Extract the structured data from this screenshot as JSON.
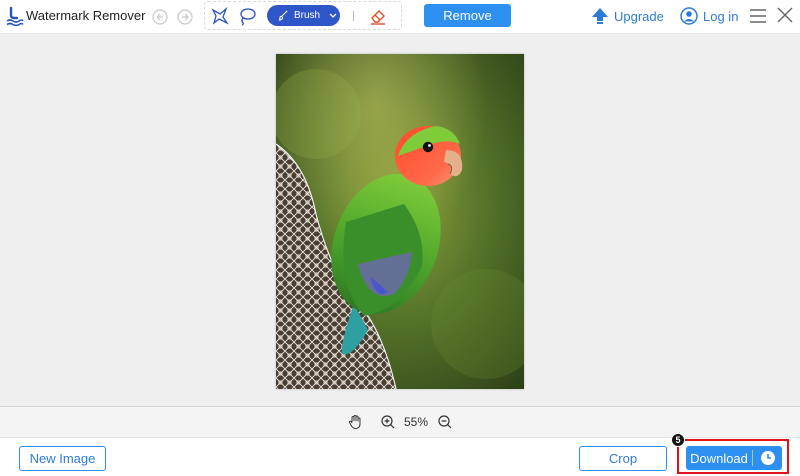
{
  "app": {
    "title": "Watermark Remover"
  },
  "toolbar": {
    "brush_label": "Brush",
    "remove_label": "Remove",
    "upgrade_label": "Upgrade",
    "login_label": "Log in"
  },
  "zoom": {
    "level": "55%"
  },
  "bottom": {
    "new_image_label": "New Image",
    "crop_label": "Crop",
    "download_label": "Download",
    "step_number": "5"
  },
  "icons": {
    "undo": "undo-icon",
    "redo": "redo-icon",
    "polygon": "polygon-select-icon",
    "lasso": "lasso-icon",
    "brush": "brush-icon",
    "eraser": "eraser-icon",
    "upgrade": "upload-arrow-icon",
    "user": "user-icon",
    "menu": "menu-icon",
    "close": "close-icon",
    "hand": "hand-icon",
    "zoom_in": "zoom-in-icon",
    "zoom_out": "zoom-out-icon",
    "clock": "clock-icon"
  },
  "colors": {
    "accent": "#2d8ff0",
    "brush_pill": "#2f56c9",
    "link": "#2d7bd9",
    "highlight": "#e0141a"
  }
}
